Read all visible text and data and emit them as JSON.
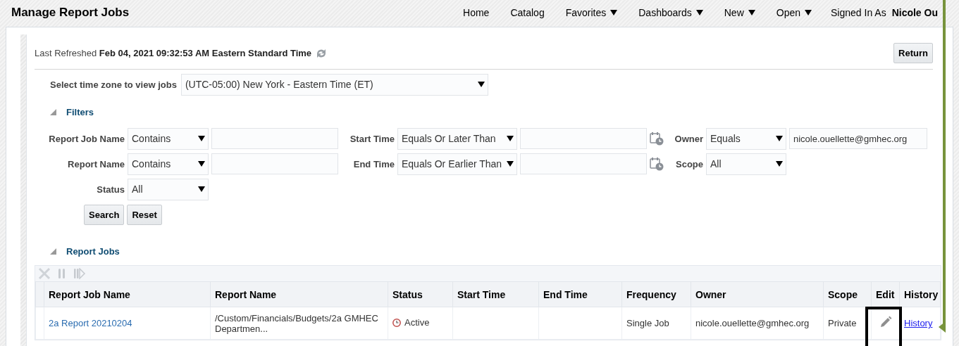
{
  "header": {
    "title": "Manage Report Jobs",
    "nav": [
      {
        "label": "Home",
        "menu": false
      },
      {
        "label": "Catalog",
        "menu": false
      },
      {
        "label": "Favorites",
        "menu": true
      },
      {
        "label": "Dashboards",
        "menu": true
      },
      {
        "label": "New",
        "menu": true
      },
      {
        "label": "Open",
        "menu": true
      }
    ],
    "signed_in_label": "Signed In As",
    "user": "Nicole Ou"
  },
  "refresh": {
    "label": "Last Refreshed",
    "value": "Feb 04, 2021 09:32:53 AM Eastern Standard Time"
  },
  "return_button": "Return",
  "timezone": {
    "label": "Select time zone to view jobs",
    "value": "(UTC-05:00) New York - Eastern Time (ET)"
  },
  "filters": {
    "title": "Filters",
    "expanded": true,
    "rows": [
      [
        {
          "kind": "text",
          "label": "Report Job Name",
          "operator": "Contains"
        },
        {
          "kind": "date",
          "label": "Start Time",
          "operator": "Equals Or Later Than"
        },
        {
          "kind": "text",
          "label": "Owner",
          "operator": "Equals",
          "value": "nicole.ouellette@gmhec.org"
        }
      ],
      [
        {
          "kind": "text",
          "label": "Report Name",
          "operator": "Contains"
        },
        {
          "kind": "date",
          "label": "End Time",
          "operator": "Equals Or Earlier Than"
        },
        {
          "kind": "choice",
          "label": "Scope",
          "operator": "All"
        }
      ],
      [
        {
          "kind": "choice",
          "label": "Status",
          "operator": "All"
        }
      ]
    ],
    "buttons": [
      "Search",
      "Reset"
    ]
  },
  "report_jobs": {
    "title": "Report Jobs",
    "expanded": true,
    "columns": [
      "Report Job Name",
      "Report Name",
      "Status",
      "Start Time",
      "End Time",
      "Frequency",
      "Owner",
      "Scope",
      "Edit",
      "History"
    ],
    "rows": [
      {
        "job_name": "2a Report 20210204",
        "report_name": "/Custom/Financials/Budgets/2a GMHEC Departmen...",
        "status": "Active",
        "start_time": "",
        "end_time": "",
        "frequency": "Single Job",
        "owner": "nicole.ouellette@gmhec.org",
        "scope": "Private",
        "history": "History"
      }
    ]
  }
}
